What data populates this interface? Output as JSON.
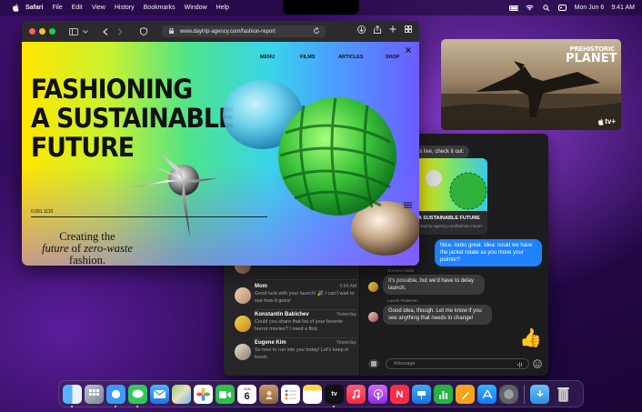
{
  "menubar": {
    "app": "Safari",
    "menus": [
      "File",
      "Edit",
      "View",
      "History",
      "Bookmarks",
      "Window",
      "Help"
    ],
    "date": "Mon Jun 6",
    "time": "9:41 AM"
  },
  "safari": {
    "url": "www.daytrip-agency.com/fashion-report",
    "page": {
      "nav": [
        "MENU",
        "FILMS",
        "ARTICLES",
        "SHOP"
      ],
      "headline": [
        "FASHIONING",
        "A SUSTAINABLE",
        "FUTURE"
      ],
      "code": "0.001.1110",
      "tagline_1": "Creating the",
      "tagline_2a": "future",
      "tagline_2b": "of",
      "tagline_2c": "zero-waste",
      "tagline_3": "fashion."
    }
  },
  "tv": {
    "title_1": "PREHISTORIC",
    "title_2": "PLANET",
    "badge": "tv+"
  },
  "messages": {
    "conversations": [
      {
        "name": "",
        "time": "",
        "preview": "way to the office this morning. Call"
      },
      {
        "name": "Mom",
        "time": "6:54 AM",
        "preview": "Good luck with your launch! 🎉 I can't wait to see how it goes!"
      },
      {
        "name": "Konstantin Babichev",
        "time": "Yesterday",
        "preview": "Could you share that list of your favorite horror movies? I need a flick"
      },
      {
        "name": "Eugene Kim",
        "time": "Yesterday",
        "preview": "So nice to run into you today! Let's keep in touch."
      }
    ],
    "thread": {
      "top_bubble": "n is live, check it out:",
      "link_title": "A SUSTAINABLE FUTURE",
      "link_url": "daytrip-agency.com/fashion-report",
      "out_bubble": "Nice, looks great. Idea: could we have the jacket rotate as you move your pointer?",
      "sender_1": "Romano Malla",
      "in_bubble_1": "It's possible, but we'd have to delay launch.",
      "sender_2": "Lanchi Pedersen",
      "in_bubble_2": "Good idea, though. Let me know if you see anything that needs to change!",
      "emoji": "👍",
      "input_placeholder": "iMessage"
    }
  },
  "dock": {
    "calendar_month": "JUN",
    "calendar_day": "6",
    "apps": [
      "Finder",
      "Launchpad",
      "Safari",
      "Messages",
      "Mail",
      "Maps",
      "Photos",
      "FaceTime",
      "Calendar",
      "Contacts",
      "Reminders",
      "Notes",
      "TV",
      "Music",
      "Podcasts",
      "News",
      "Keynote",
      "Numbers",
      "Pages",
      "App Store",
      "System Preferences",
      "Downloads",
      "Trash"
    ]
  }
}
